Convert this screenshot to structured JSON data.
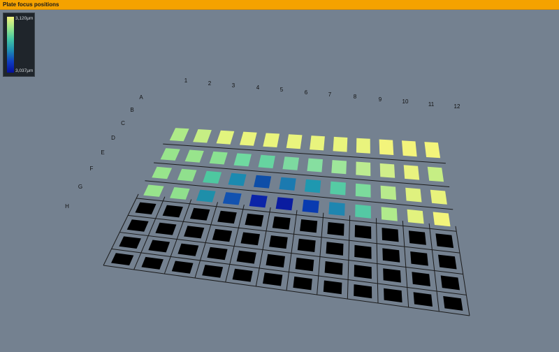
{
  "window": {
    "title": "Plate focus positions"
  },
  "legend": {
    "max_label": "3,120μm",
    "min_label": "3,037μm",
    "gradient_colors": [
      "#f4f37e",
      "#9ce78a",
      "#44c6a4",
      "#1f8fb2",
      "#0f3ec0",
      "#050f9c"
    ]
  },
  "plate": {
    "columns": [
      "1",
      "2",
      "3",
      "4",
      "5",
      "6",
      "7",
      "8",
      "9",
      "10",
      "11",
      "12"
    ],
    "rows": [
      "A",
      "B",
      "C",
      "D",
      "E",
      "F",
      "G",
      "H"
    ],
    "unmeasured_color": "#000000",
    "grid_color": "#1b1b1b",
    "wells": [
      [
        "#aeea88",
        "#c6ee84",
        "#e2f47e",
        "#e9f47d",
        "#e9f47d",
        "#e9f47d",
        "#e9f47d",
        "#e9f47d",
        "#e9f47d",
        "#f3f47b",
        "#f3f47b",
        "#f3f47b"
      ],
      [
        "#98e48c",
        "#98e48c",
        "#8ae191",
        "#6fd9a0",
        "#66d4a0",
        "#7dd9a0",
        "#86dfa0",
        "#9ee69a",
        "#bceb90",
        "#d0ee8a",
        "#e9f27f",
        "#c6ee84"
      ],
      [
        "#98e48c",
        "#90e08d",
        "#4ec8a0",
        "#1b8ab0",
        "#0e4ea8",
        "#1b7ab0",
        "#1e98b0",
        "#55cba4",
        "#7cdb9c",
        "#b8ea8c",
        "#dff17e",
        "#e8f37c"
      ],
      [
        "#98e48c",
        "#90e08d",
        "#1e8faa",
        "#1252b0",
        "#0b24a8",
        "#0a1ca0",
        "#093bb0",
        "#1f86b0",
        "#54c9a4",
        "#b0ea8c",
        "#e2f27e",
        "#f3f47b"
      ],
      [
        null,
        null,
        null,
        null,
        null,
        null,
        null,
        null,
        null,
        null,
        null,
        null
      ],
      [
        null,
        null,
        null,
        null,
        null,
        null,
        null,
        null,
        null,
        null,
        null,
        null
      ],
      [
        null,
        null,
        null,
        null,
        null,
        null,
        null,
        null,
        null,
        null,
        null,
        null
      ],
      [
        null,
        null,
        null,
        null,
        null,
        null,
        null,
        null,
        null,
        null,
        null,
        null
      ]
    ]
  }
}
